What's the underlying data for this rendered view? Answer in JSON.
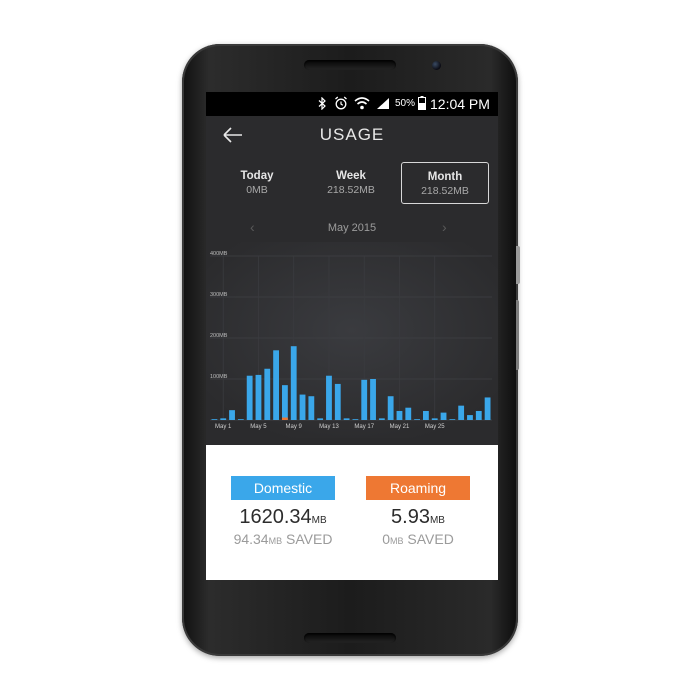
{
  "status_bar": {
    "icons": [
      "bluetooth-icon",
      "alarm-icon",
      "wifi-icon",
      "signal-icon",
      "battery-icon"
    ],
    "battery": "50%",
    "time": "12:04 PM"
  },
  "header": {
    "title": "USAGE",
    "back_icon": "arrow-left-icon"
  },
  "tabs": [
    {
      "label": "Today",
      "value": "0MB"
    },
    {
      "label": "Week",
      "value": "218.52MB"
    },
    {
      "label": "Month",
      "value": "218.52MB",
      "selected": true
    }
  ],
  "period": {
    "label": "May 2015",
    "prev_icon": "chevron-left-icon",
    "next_icon": "chevron-right-icon"
  },
  "chart_data": {
    "type": "bar",
    "title": "",
    "y_ticks": [
      "400MB",
      "300MB",
      "200MB",
      "100MB"
    ],
    "x_tick_labels": [
      "May 1",
      "May 5",
      "May 9",
      "May 13",
      "May 17",
      "May 21",
      "May 25"
    ],
    "ylim": [
      0,
      400
    ],
    "grid": true,
    "categories": [
      "May 1",
      "May 2",
      "May 3",
      "May 4",
      "May 5",
      "May 6",
      "May 7",
      "May 8",
      "May 9",
      "May 10",
      "May 11",
      "May 12",
      "May 13",
      "May 14",
      "May 15",
      "May 16",
      "May 17",
      "May 18",
      "May 19",
      "May 20",
      "May 21",
      "May 22",
      "May 23",
      "May 24",
      "May 25",
      "May 26",
      "May 27",
      "May 28"
    ],
    "series": [
      {
        "color": "#3aa7ea",
        "values": [
          2,
          4,
          24,
          2,
          108,
          110,
          125,
          170,
          85,
          180,
          62,
          58,
          4,
          108,
          88,
          4,
          2,
          98,
          100,
          4,
          58,
          22,
          30,
          2,
          22,
          4,
          18,
          2,
          35,
          12,
          22,
          55
        ]
      },
      {
        "color": "#ee7833",
        "values": [
          0,
          0,
          0,
          0,
          0,
          0,
          0,
          0,
          6,
          0,
          0,
          0,
          0,
          0,
          0,
          0,
          0,
          0,
          0,
          0,
          0,
          0,
          0,
          0,
          0,
          0,
          0,
          0,
          0,
          0,
          0,
          0
        ]
      }
    ],
    "bar_count": 32
  },
  "summary": {
    "domestic": {
      "label": "Domestic",
      "amount": "1620.34",
      "unit": "MB",
      "saved_amount": "94.34",
      "saved_unit": "MB",
      "saved_suffix": "SAVED",
      "color": "#3aa7ea"
    },
    "roaming": {
      "label": "Roaming",
      "amount": "5.93",
      "unit": "MB",
      "saved_amount": "0",
      "saved_unit": "MB",
      "saved_suffix": "SAVED",
      "color": "#ee7833"
    }
  }
}
